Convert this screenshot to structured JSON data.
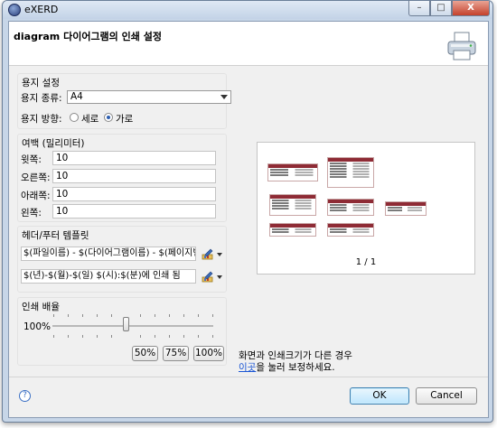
{
  "window": {
    "title": "eXERD",
    "controls": {
      "minimize": "–",
      "maximize": "□",
      "close": "X"
    }
  },
  "header": {
    "title": "diagram 다이어그램의 인쇄 설정",
    "icon": "printer-icon"
  },
  "paper": {
    "group_label": "용지 설정",
    "type_label": "용지 종류:",
    "type_value": "A4",
    "orientation_label": "용지 방향:",
    "portrait_label": "세로",
    "landscape_label": "가로",
    "orientation_selected": "가로"
  },
  "margins": {
    "group_label": "여백 (밀리미터)",
    "top_label": "윗쪽:",
    "top_value": "10",
    "right_label": "오른쪽:",
    "right_value": "10",
    "bottom_label": "아래쪽:",
    "bottom_value": "10",
    "left_label": "왼쪽:",
    "left_value": "10"
  },
  "templates": {
    "group_label": "헤더/푸터 템플릿",
    "header_value": "$(파일이름) - $(다이어그램이름) - $(페이지번호)",
    "footer_value": "$(년)-$(월)-$(일) $(시):$(분)에 인쇄 됨"
  },
  "scale": {
    "group_label": "인쇄 배율",
    "value_label": "100%",
    "level_percent": 100,
    "btn_50": "50%",
    "btn_75": "75%",
    "btn_100": "100%"
  },
  "preview": {
    "page_indicator": "1 / 1"
  },
  "note": {
    "line1": "화면과 인쇄크기가 다른 경우",
    "link": "이곳",
    "line2_rest": "을 눌러 보정하세요."
  },
  "footer": {
    "help_icon": "?",
    "ok_label": "OK",
    "cancel_label": "Cancel"
  },
  "colors": {
    "accent": "#3c7fb1",
    "link": "#1a55d4",
    "table_header": "#8e2b35"
  }
}
